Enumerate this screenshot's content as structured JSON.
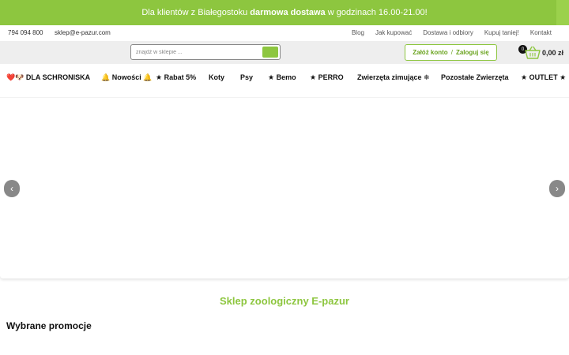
{
  "promo": {
    "text_before": "Dla klientów z Białegostoku",
    "text_bold": "darmowa dostawa",
    "text_after": "w godzinach 16.00-21.00!"
  },
  "contact": {
    "phone": "794 094 800",
    "email": "sklep@e-pazur.com"
  },
  "top_links": [
    "Blog",
    "Jak kupować",
    "Dostawa i odbiory",
    "Kupuj taniej!",
    "Kontakt"
  ],
  "search": {
    "placeholder": "znajdź w sklepie ..."
  },
  "account": {
    "register_label": "Załóż konto",
    "separator": "/",
    "login_label": "Zaloguj się"
  },
  "cart": {
    "count": "0",
    "total": "0,00 zł"
  },
  "nav": {
    "items": [
      "❤️🐶 DLA SCHRONISKA",
      "🔔 Nowości 🔔",
      "★ Rabat 5%",
      "Koty",
      "Psy",
      "★ Bemo",
      "★ PERRO",
      "Zwierzęta zimujące ❄",
      "Pozostałe Zwierzęta",
      "★ OUTLET ★"
    ]
  },
  "slider": {
    "prev_symbol": "‹",
    "next_symbol": "›"
  },
  "main": {
    "shop_title": "Sklep zoologiczny E-pazur",
    "promotions_title": "Wybrane promocje"
  },
  "colors": {
    "brand_green": "#8dc63f",
    "arrow_gray": "#888888"
  }
}
